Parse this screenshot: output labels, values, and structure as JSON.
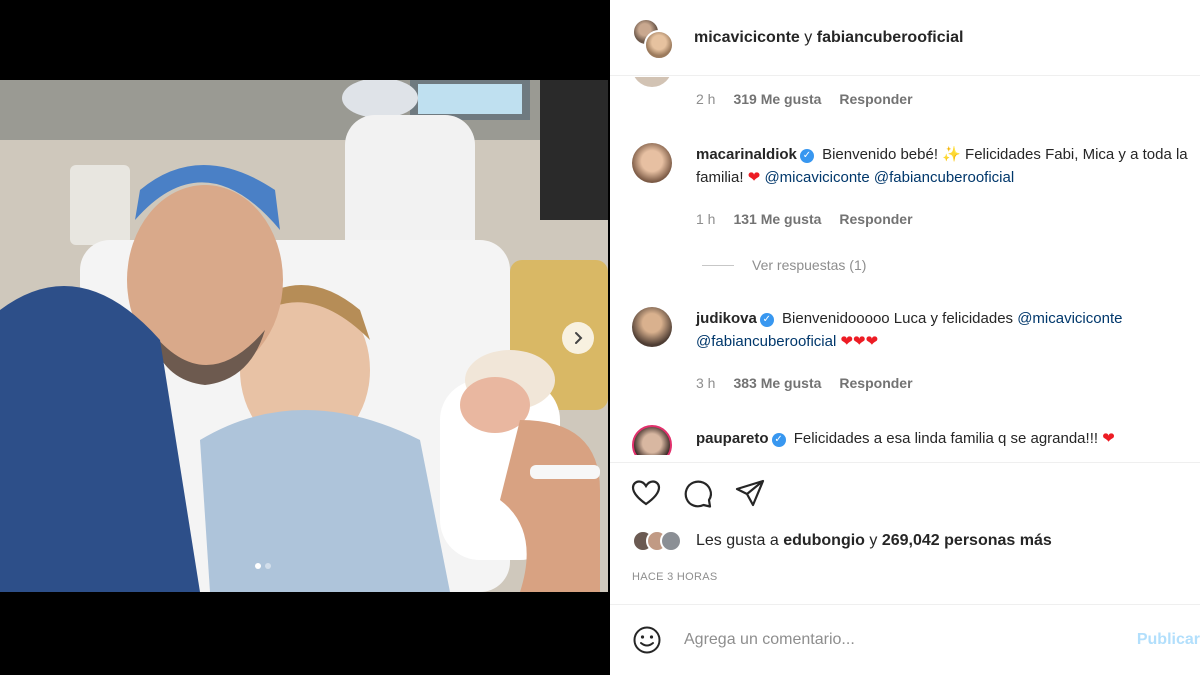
{
  "post_header": {
    "user1": "micaviciconte",
    "conjunction": "y",
    "user2": "fabiancuberooficial"
  },
  "comments": [
    {
      "time": "2 h",
      "likes": "319 Me gusta",
      "reply": "Responder"
    },
    {
      "user": "macarinaldiok",
      "text_before": "Bienvenido bebé! ",
      "text_after": " Felicidades Fabi, Mica y a toda la familia! ",
      "mention1": "@micaviciconte",
      "mention2": "@fabiancuberooficial",
      "time": "1 h",
      "likes": "131 Me gusta",
      "reply": "Responder",
      "view_replies": "Ver respuestas (1)"
    },
    {
      "user": "judikova",
      "text": "Bienvenidooooo Luca y felicidades ",
      "mention1": "@micaviciconte",
      "mention2": "@fabiancuberooficial",
      "hearts": "❤❤❤",
      "time": "3 h",
      "likes": "383 Me gusta",
      "reply": "Responder"
    },
    {
      "user": "paupareto",
      "text": "Felicidades a esa linda familia q se agranda!!! "
    }
  ],
  "likes": {
    "prefix": "Les gusta a ",
    "user": "edubongio",
    "middle": " y ",
    "count": "269,042 personas más"
  },
  "timestamp": "HACE 3 HORAS",
  "add_comment": {
    "placeholder": "Agrega un comentario...",
    "post_label": "Publicar"
  },
  "colors": {
    "mention": "#00376b",
    "verified": "#3897f0",
    "heart": "#ed1c24",
    "post_button": "#b2dffc"
  },
  "icons": [
    "heart-icon",
    "comment-icon",
    "share-icon",
    "emoji-icon",
    "chevron-right-icon",
    "verified-icon"
  ]
}
